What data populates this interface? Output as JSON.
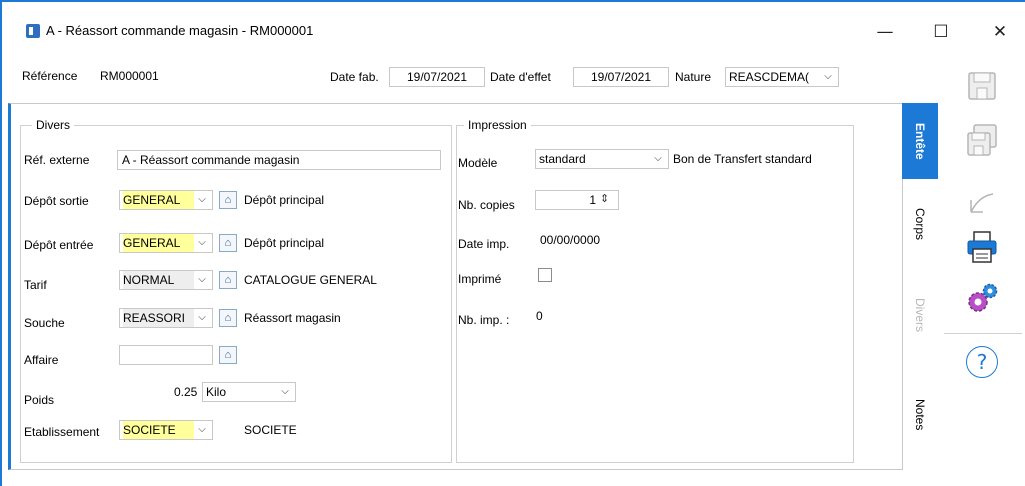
{
  "window": {
    "title": "A - Réassort commande magasin - RM000001",
    "minimize": "—",
    "maximize": "☐",
    "close": "✕"
  },
  "header": {
    "reference_label": "Référence",
    "reference_value": "RM000001",
    "date_fab_label": "Date fab.",
    "date_fab_value": "19/07/2021",
    "date_effet_label": "Date d'effet",
    "date_effet_value": "19/07/2021",
    "nature_label": "Nature",
    "nature_value": "REASCDEMA("
  },
  "divers": {
    "legend": "Divers",
    "ref_externe_label": "Réf. externe",
    "ref_externe_value": "A - Réassort commande magasin",
    "depot_sortie_label": "Dépôt sortie",
    "depot_sortie_value": "GENERAL",
    "depot_sortie_desc": "Dépôt principal",
    "depot_entree_label": "Dépôt entrée",
    "depot_entree_value": "GENERAL",
    "depot_entree_desc": "Dépôt principal",
    "tarif_label": "Tarif",
    "tarif_value": "NORMAL",
    "tarif_desc": "CATALOGUE GENERAL",
    "souche_label": "Souche",
    "souche_value": "REASSORI",
    "souche_desc": "Réassort magasin",
    "affaire_label": "Affaire",
    "affaire_value": "",
    "poids_label": "Poids",
    "poids_value": "0.25",
    "poids_unit": "Kilo",
    "etablissement_label": "Etablissement",
    "etablissement_value": "SOCIETE",
    "etablissement_desc": "SOCIETE"
  },
  "impression": {
    "legend": "Impression",
    "modele_label": "Modèle",
    "modele_value": "standard",
    "modele_desc": "Bon de Transfert standard",
    "nb_copies_label": "Nb. copies",
    "nb_copies_value": "1",
    "date_imp_label": "Date imp.",
    "date_imp_value": "00/00/0000",
    "imprime_label": "Imprimé",
    "imprime_checked": false,
    "nb_imp_label": "Nb. imp. :",
    "nb_imp_value": "0"
  },
  "tabs": [
    {
      "label": "Entête",
      "state": "active"
    },
    {
      "label": "Corps",
      "state": "normal"
    },
    {
      "label": "Divers",
      "state": "disabled"
    },
    {
      "label": "Notes",
      "state": "normal"
    }
  ],
  "toolbar": {
    "save_icon": "save-icon",
    "save_all_icon": "save-all-icon",
    "undo_icon": "undo-icon",
    "print_icon": "print-icon",
    "settings_icon": "gears-icon",
    "help_icon": "help-icon",
    "help_glyph": "?"
  },
  "colors": {
    "accent": "#1c7ad6",
    "mandatory_field": "#ffff9c"
  },
  "glyphs": {
    "chevron": "⌵",
    "home": "⌂",
    "spin": "⇕"
  }
}
